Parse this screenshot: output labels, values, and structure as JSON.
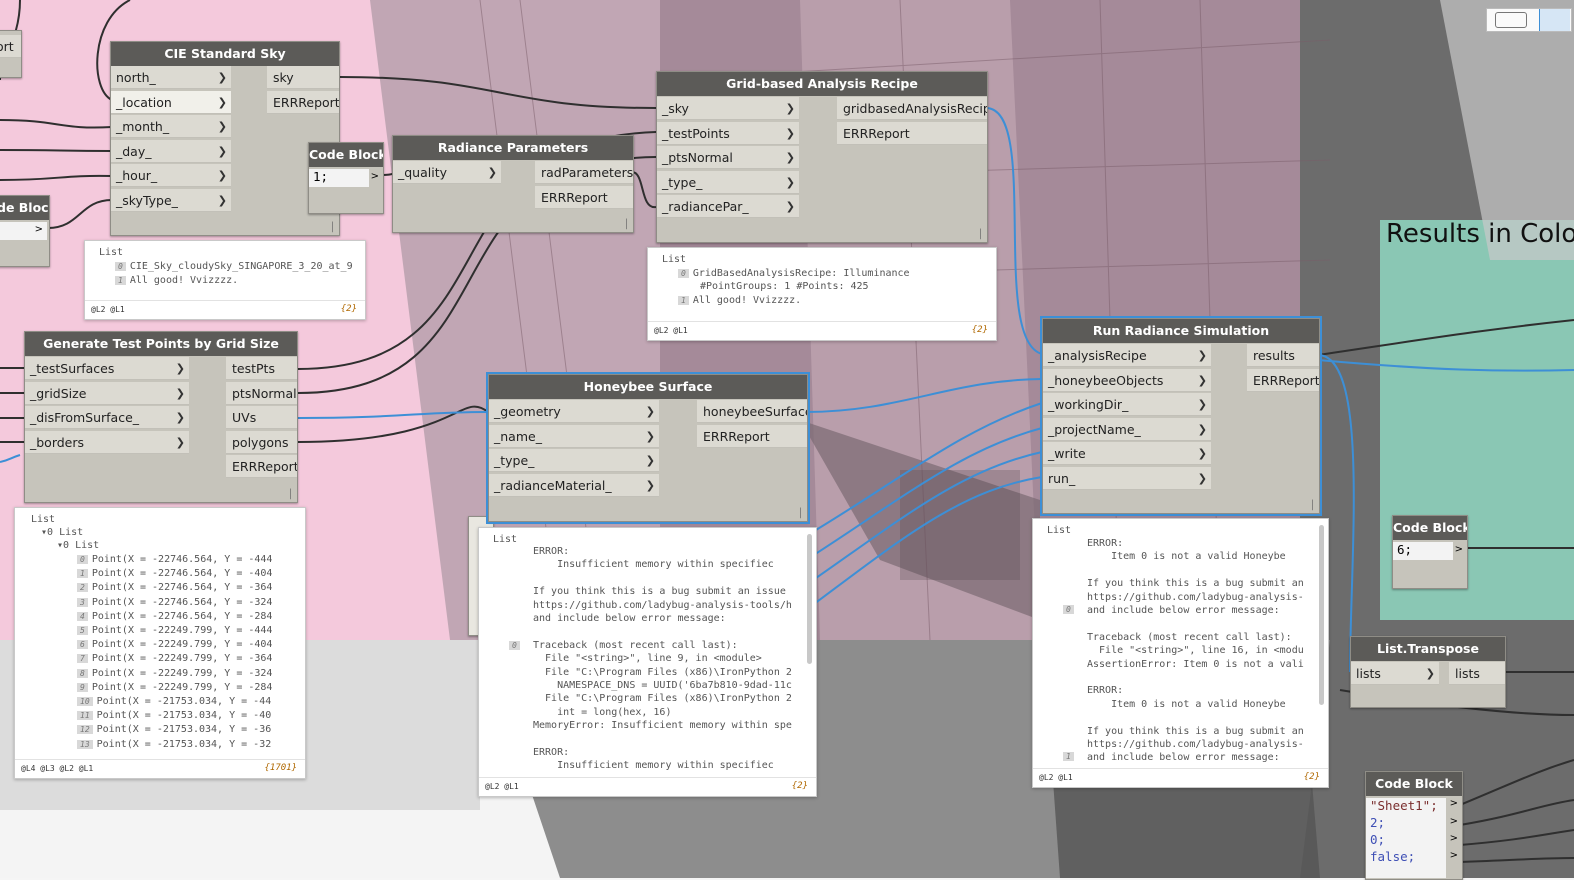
{
  "nodes": {
    "cie_sky": {
      "title": "CIE Standard Sky",
      "inputs": [
        "north_",
        "_location",
        "_month_",
        "_day_",
        "_hour_",
        "_skyType_"
      ],
      "outputs": [
        "sky",
        "ERRReport"
      ]
    },
    "radiance_params": {
      "title": "Radiance Parameters",
      "inputs": [
        "_quality"
      ],
      "outputs": [
        "radParameters",
        "ERRReport"
      ]
    },
    "grid_recipe": {
      "title": "Grid-based Analysis Recipe",
      "inputs": [
        "_sky",
        "_testPoints",
        "_ptsNormal",
        "_type_",
        "_radiancePar_"
      ],
      "outputs": [
        "gridbasedAnalysisRecipe",
        "ERRReport"
      ]
    },
    "test_points": {
      "title": "Generate Test Points by Grid Size",
      "inputs": [
        "_testSurfaces",
        "_gridSize",
        "_disFromSurface_",
        "_borders"
      ],
      "outputs": [
        "testPts",
        "ptsNormal",
        "UVs",
        "polygons",
        "ERRReport"
      ]
    },
    "hb_surface": {
      "title": "Honeybee Surface",
      "inputs": [
        "_geometry",
        "_name_",
        "_type_",
        "_radianceMaterial_"
      ],
      "outputs": [
        "honeybeeSurface",
        "ERRReport"
      ]
    },
    "run_radiance": {
      "title": "Run Radiance Simulation",
      "inputs": [
        "_analysisRecipe",
        "_honeybeeObjects",
        "_workingDir_",
        "_projectName_",
        "_write",
        "run_"
      ],
      "outputs": [
        "results",
        "ERRReport"
      ]
    },
    "code_block_1": {
      "title": "Code Block",
      "lines": [
        "1;"
      ]
    },
    "code_block_left": {
      "title": "de Block"
    },
    "code_block_2": {
      "title": "Code Block",
      "lines": [
        "6;"
      ]
    },
    "list_transpose": {
      "title": "List.Transpose",
      "inputs": [
        "lists"
      ],
      "outputs": [
        "lists"
      ]
    },
    "code_block_3": {
      "title": "Code Block",
      "lines": [
        "\"Sheet1\";",
        "2;",
        "0;",
        "false;"
      ]
    },
    "partial_top_left": {
      "label": "ort"
    }
  },
  "previews": {
    "sky": {
      "header": "List",
      "items": [
        "CIE_Sky_cloudySky_SINGAPORE_3_20_at_9",
        "All good! Vvizzzz."
      ],
      "levels": "@L2 @L1",
      "count": "{2}"
    },
    "recipe": {
      "header": "List",
      "items": [
        "GridBasedAnalysisRecipe: Illuminance",
        "#PointGroups: 1 #Points: 425",
        "All good! Vvizzzz."
      ],
      "levels": "@L2 @L1",
      "count": "{2}"
    },
    "points": {
      "header": "List",
      "sub1": "0 List",
      "sub2": "0 List",
      "items": [
        "Point(X = -22746.564, Y = -444",
        "Point(X = -22746.564, Y = -404",
        "Point(X = -22746.564, Y = -364",
        "Point(X = -22746.564, Y = -324",
        "Point(X = -22746.564, Y = -284",
        "Point(X = -22249.799, Y = -444",
        "Point(X = -22249.799, Y = -404",
        "Point(X = -22249.799, Y = -364",
        "Point(X = -22249.799, Y = -324",
        "Point(X = -22249.799, Y = -284",
        "Point(X = -21753.034, Y = -44",
        "Point(X = -21753.034, Y = -40",
        "Point(X = -21753.034, Y = -36",
        "Point(X = -21753.034, Y = -32"
      ],
      "levels": "@L4 @L3 @L2 @L1",
      "count": "{1701}"
    },
    "hb": {
      "header": "List",
      "lines": [
        "ERROR:",
        "    Insufficient memory within specifiec",
        "",
        "If you think this is a bug submit an issue",
        "https://github.com/ladybug-analysis-tools/h",
        "and include below error message:",
        "",
        "Traceback (most recent call last):",
        "  File \"<string>\", line 9, in <module>",
        "  File \"C:\\Program Files (x86)\\IronPython 2",
        "    NAMESPACE_DNS = UUID('6ba7b810-9dad-11c",
        "  File \"C:\\Program Files (x86)\\IronPython 2",
        "    int = long(hex, 16)",
        "MemoryError: Insufficient memory within spe",
        "",
        "ERROR:",
        "    Insufficient memory within specifiec"
      ],
      "levels": "@L2 @L1",
      "count": "{2}"
    },
    "run": {
      "header": "List",
      "lines": [
        "ERROR:",
        "    Item 0 is not a valid Honeybe",
        "",
        "If you think this is a bug submit an",
        "https://github.com/ladybug-analysis-",
        "and include below error message:",
        "",
        "Traceback (most recent call last):",
        "  File \"<string>\", line 16, in <modu",
        "AssertionError: Item 0 is not a vali",
        "",
        "ERROR:",
        "    Item 0 is not a valid Honeybe",
        "",
        "If you think this is a bug submit an",
        "https://github.com/ladybug-analysis-",
        "and include below error message:"
      ],
      "levels": "@L2 @L1",
      "count": "{2}"
    }
  },
  "index_labels": [
    "0",
    "1",
    "2",
    "3",
    "4",
    "5",
    "6",
    "7",
    "8",
    "9",
    "10",
    "11",
    "12",
    "13"
  ],
  "canvas": {
    "results_title": "Results in Colo"
  },
  "colors": {
    "wire_blue": "#3d8fd6",
    "wire_dark": "#2f2f2f",
    "node_title": "#5c5b58",
    "node_body": "#c6c4bb",
    "pink_zone": "#f2c6da"
  }
}
